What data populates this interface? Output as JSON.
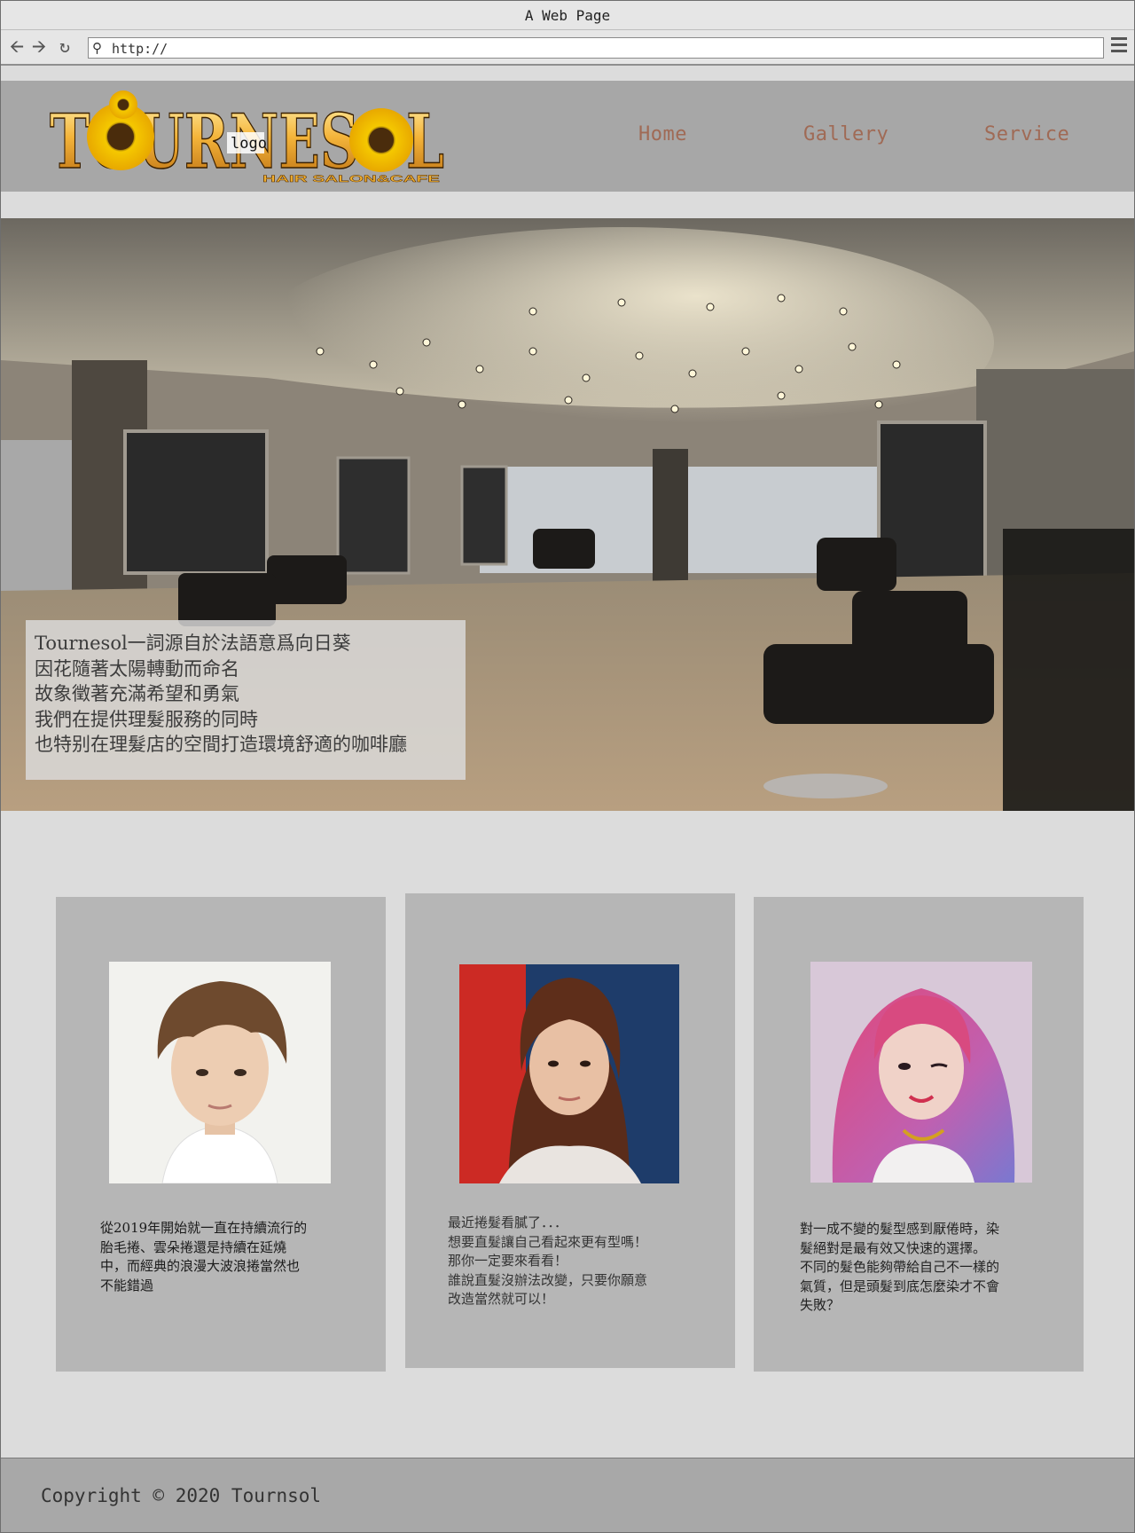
{
  "browser": {
    "title": "A Web Page",
    "url": "http://"
  },
  "header": {
    "logo_label": "logo",
    "logo_wordmark": "TOURNESOL",
    "logo_tagline": "HAIR SALON&CAFE",
    "nav": [
      "Home",
      "Gallery",
      "Service"
    ]
  },
  "hero": {
    "lines": [
      "Tournesol一詞源自於法語意爲向日葵",
      "因花隨著太陽轉動而命名",
      "故象徵著充滿希望和勇氣",
      "我們在提供理髮服務的同時",
      "也特别在理髮店的空間打造環境舒適的咖啡廳"
    ]
  },
  "cards": [
    {
      "photo": "man-with-wavy-brown-hair-photo",
      "lines": [
        "從2019年開始就一直在持續流行的",
        "胎毛捲、雲朵捲還是持續在延燒",
        "中，而經典的浪漫大波浪捲當然也",
        "不能錯過"
      ]
    },
    {
      "photo": "woman-with-straight-brown-hair-photo",
      "lines": [
        "最近捲髮看膩了．．．",
        "想要直髮讓自己看起來更有型嗎！",
        "那你一定要來看看！",
        "誰說直髮沒辦法改變，只要你願意",
        "改造當然就可以！"
      ]
    },
    {
      "photo": "woman-with-pink-purple-hair-photo",
      "lines": [
        "對一成不變的髮型感到厭倦時，染",
        "髮絕對是最有效又快速的選擇。",
        "不同的髮色能夠帶給自己不一樣的",
        "氣質，但是頭髮到底怎麼染才不會",
        "失敗？"
      ]
    }
  ],
  "footer": {
    "copyright": "Copyright © 2020 Tournsol"
  },
  "colors": {
    "header_bg": "#a7a7a7",
    "nav_text": "#a06a55",
    "page_bg": "#dcdcdc",
    "card_bg": "#b6b6b6",
    "footer_bg": "#a8a8a8"
  }
}
